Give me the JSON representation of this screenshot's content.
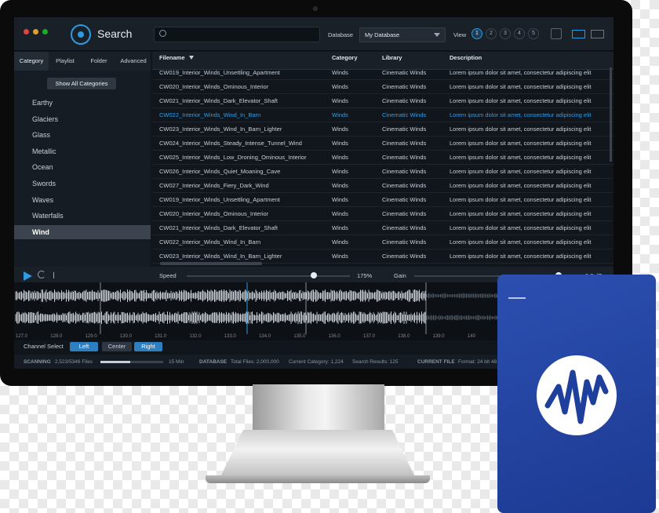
{
  "app": {
    "title": "Search"
  },
  "search": {
    "placeholder": ""
  },
  "database": {
    "label": "Database",
    "value": "My Database"
  },
  "view": {
    "label": "View",
    "pages": [
      "1",
      "2",
      "3",
      "4",
      "5"
    ],
    "active": "1"
  },
  "tabs": [
    "Category",
    "Playlist",
    "Folder",
    "Advanced"
  ],
  "sidebar": {
    "show_all": "Show All Categories",
    "categories": [
      "Earthy",
      "Glaciers",
      "Glass",
      "Metallic",
      "Ocean",
      "Swords",
      "Waves",
      "Waterfalls",
      "Wind"
    ],
    "selected": "Wind"
  },
  "table": {
    "headers": [
      "Filename",
      "Category",
      "Library",
      "Description"
    ],
    "rows": [
      [
        "CW019_Interior_Winds_Unsettling_Apartment",
        "Winds",
        "Cinematic Winds",
        "Lorem ipsum dolor sit amet, consectetur adipiscing elit"
      ],
      [
        "CW020_Interior_Winds_Ominous_Interior",
        "Winds",
        "Cinematic Winds",
        "Lorem ipsum dolor sit amet, consectetur adipiscing elit"
      ],
      [
        "CW021_Interior_Winds_Dark_Elevator_Shaft",
        "Winds",
        "Cinematic Winds",
        "Lorem ipsum dolor sit amet, consectetur adipiscing elit"
      ],
      [
        "CW022_Interior_Winds_Wind_In_Barn",
        "Winds",
        "Cinematic Winds",
        "Lorem ipsum dolor sit amet, consectetur adipiscing elit"
      ],
      [
        "CW023_Interior_Winds_Wind_In_Barn_Lighter",
        "Winds",
        "Cinematic Winds",
        "Lorem ipsum dolor sit amet, consectetur adipiscing elit"
      ],
      [
        "CW024_Interior_Winds_Steady_Intense_Tunnel_Wind",
        "Winds",
        "Cinematic Winds",
        "Lorem ipsum dolor sit amet, consectetur adipiscing elit"
      ],
      [
        "CW025_Interior_Winds_Low_Droning_Ominous_Interior",
        "Winds",
        "Cinematic Winds",
        "Lorem ipsum dolor sit amet, consectetur adipiscing elit"
      ],
      [
        "CW026_Interior_Winds_Quiet_Moaning_Cave",
        "Winds",
        "Cinematic Winds",
        "Lorem ipsum dolor sit amet, consectetur adipiscing elit"
      ],
      [
        "CW027_Interior_Winds_Fiery_Dark_Wind",
        "Winds",
        "Cinematic Winds",
        "Lorem ipsum dolor sit amet, consectetur adipiscing elit"
      ],
      [
        "CW019_Interior_Winds_Unsettling_Apartment",
        "Winds",
        "Cinematic Winds",
        "Lorem ipsum dolor sit amet, consectetur adipiscing elit"
      ],
      [
        "CW020_Interior_Winds_Ominous_Interior",
        "Winds",
        "Cinematic Winds",
        "Lorem ipsum dolor sit amet, consectetur adipiscing elit"
      ],
      [
        "CW021_Interior_Winds_Dark_Elevator_Shaft",
        "Winds",
        "Cinematic Winds",
        "Lorem ipsum dolor sit amet, consectetur adipiscing elit"
      ],
      [
        "CW022_Interior_Winds_Wind_In_Barn",
        "Winds",
        "Cinematic Winds",
        "Lorem ipsum dolor sit amet, consectetur adipiscing elit"
      ],
      [
        "CW023_Interior_Winds_Wind_In_Barn_Lighter",
        "Winds",
        "Cinematic Winds",
        "Lorem ipsum dolor sit amet, consectetur adipiscing elit"
      ]
    ],
    "selected_row": 3
  },
  "transport": {
    "speed_label": "Speed",
    "speed_value": "175%",
    "gain_label": "Gain",
    "gain_value": "0.0 dB",
    "speed_level": 0.78,
    "gain_level": 0.92
  },
  "ruler": [
    "127.0",
    "128.0",
    "129.0",
    "130.0",
    "131.0",
    "132.0",
    "133.0",
    "134.0",
    "135.0",
    "136.0",
    "137.0",
    "138.0",
    "139.0",
    "140"
  ],
  "channel": {
    "label": "Channel Select",
    "left": "Left",
    "center": "Center",
    "right": "Right"
  },
  "status": {
    "scanning_label": "SCANNING",
    "scanning_value": "2,523/5346 Files",
    "scanning_progress": 0.47,
    "scanning_time": "15 Min",
    "database_label": "DATABASE",
    "total_files": "Total Files: 2,000,000",
    "current_category": "Current Category: 1,224",
    "search_results": "Search Results: 125",
    "current_file_label": "CURRENT FILE",
    "format": "Format: 24 bit 48"
  },
  "colors": {
    "accent": "#2d9be0",
    "drive": "#2c4fb0",
    "selected_text": "#2f9ee6"
  }
}
